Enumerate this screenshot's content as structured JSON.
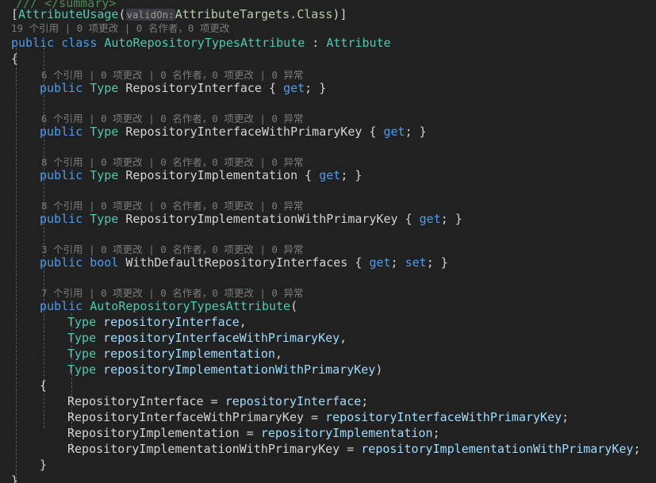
{
  "editor": {
    "language": "csharp",
    "theme": "dark",
    "background_color": "#212121",
    "indent_guide_color": "#5a5a5a",
    "colors": {
      "keyword": "#4a9df0",
      "type": "#4ec9b0",
      "identifier": "#d4d4d4",
      "parameter": "#9cdcfe",
      "enum_value": "#b5cea8",
      "comment": "#4f8a4f",
      "codelens": "#7c7c7c",
      "inlay_hint_text": "#9a9a8a",
      "inlay_hint_background": "#3b3b45"
    }
  },
  "codelens": {
    "class": "19 个引用 | 0 项更改 | 0 名作者，0 项更改",
    "repository_interface": "6 个引用 | 0 项更改 | 0 名作者，0 项更改 | 0 异常",
    "repository_interface_pk": "6 个引用 | 0 项更改 | 0 名作者，0 项更改 | 0 异常",
    "repository_implementation": "8 个引用 | 0 项更改 | 0 名作者，0 项更改 | 0 异常",
    "repository_implementation_pk": "8 个引用 | 0 项更改 | 0 名作者，0 项更改 | 0 异常",
    "with_default_repository_interfaces": "3 个引用 | 0 项更改 | 0 名作者，0 项更改 | 0 异常",
    "constructor": "7 个引用 | 0 项更改 | 0 名作者，0 项更改 | 0 异常"
  },
  "code": {
    "doc_comment_end": "/// </summary>",
    "attribute": {
      "open_bracket": "[",
      "name": "AttributeUsage",
      "open_paren": "(",
      "inlay_hint": "validOn:",
      "argument": "AttributeTargets.Class",
      "close_paren": ")",
      "close_bracket": "]"
    },
    "class_decl": {
      "modifier": "public",
      "keyword": "class",
      "name": "AutoRepositoryTypesAttribute",
      "colon": " : ",
      "base": "Attribute"
    },
    "brace_open_class": "{",
    "brace_close_class": "}",
    "properties": [
      {
        "modifier": "public",
        "type": "Type",
        "name": "RepositoryInterface",
        "accessors_open": "{",
        "get": "get",
        "semicolon_get": ";",
        "accessors_close": "}"
      },
      {
        "modifier": "public",
        "type": "Type",
        "name": "RepositoryInterfaceWithPrimaryKey",
        "accessors_open": "{",
        "get": "get",
        "semicolon_get": ";",
        "accessors_close": "}"
      },
      {
        "modifier": "public",
        "type": "Type",
        "name": "RepositoryImplementation",
        "accessors_open": "{",
        "get": "get",
        "semicolon_get": ";",
        "accessors_close": "}"
      },
      {
        "modifier": "public",
        "type": "Type",
        "name": "RepositoryImplementationWithPrimaryKey",
        "accessors_open": "{",
        "get": "get",
        "semicolon_get": ";",
        "accessors_close": "}"
      },
      {
        "modifier": "public",
        "type": "bool",
        "name": "WithDefaultRepositoryInterfaces",
        "accessors_open": "{",
        "get": "get",
        "semicolon_get": ";",
        "set": "set",
        "semicolon_set": ";",
        "accessors_close": "}"
      }
    ],
    "constructor": {
      "modifier": "public",
      "name": "AutoRepositoryTypesAttribute",
      "open_paren": "(",
      "parameters": [
        {
          "type": "Type",
          "name": "repositoryInterface",
          "trailing": ","
        },
        {
          "type": "Type",
          "name": "repositoryInterfaceWithPrimaryKey",
          "trailing": ","
        },
        {
          "type": "Type",
          "name": "repositoryImplementation",
          "trailing": ","
        },
        {
          "type": "Type",
          "name": "repositoryImplementationWithPrimaryKey",
          "trailing": ")"
        }
      ],
      "brace_open": "{",
      "brace_close": "}",
      "assignments": [
        {
          "target": "RepositoryInterface",
          "operator": " = ",
          "value": "repositoryInterface",
          "semicolon": ";"
        },
        {
          "target": "RepositoryInterfaceWithPrimaryKey",
          "operator": " = ",
          "value": "repositoryInterfaceWithPrimaryKey",
          "semicolon": ";"
        },
        {
          "target": "RepositoryImplementation",
          "operator": " = ",
          "value": "repositoryImplementation",
          "semicolon": ";"
        },
        {
          "target": "RepositoryImplementationWithPrimaryKey",
          "operator": " = ",
          "value": "repositoryImplementationWithPrimaryKey",
          "semicolon": ";"
        }
      ]
    }
  }
}
